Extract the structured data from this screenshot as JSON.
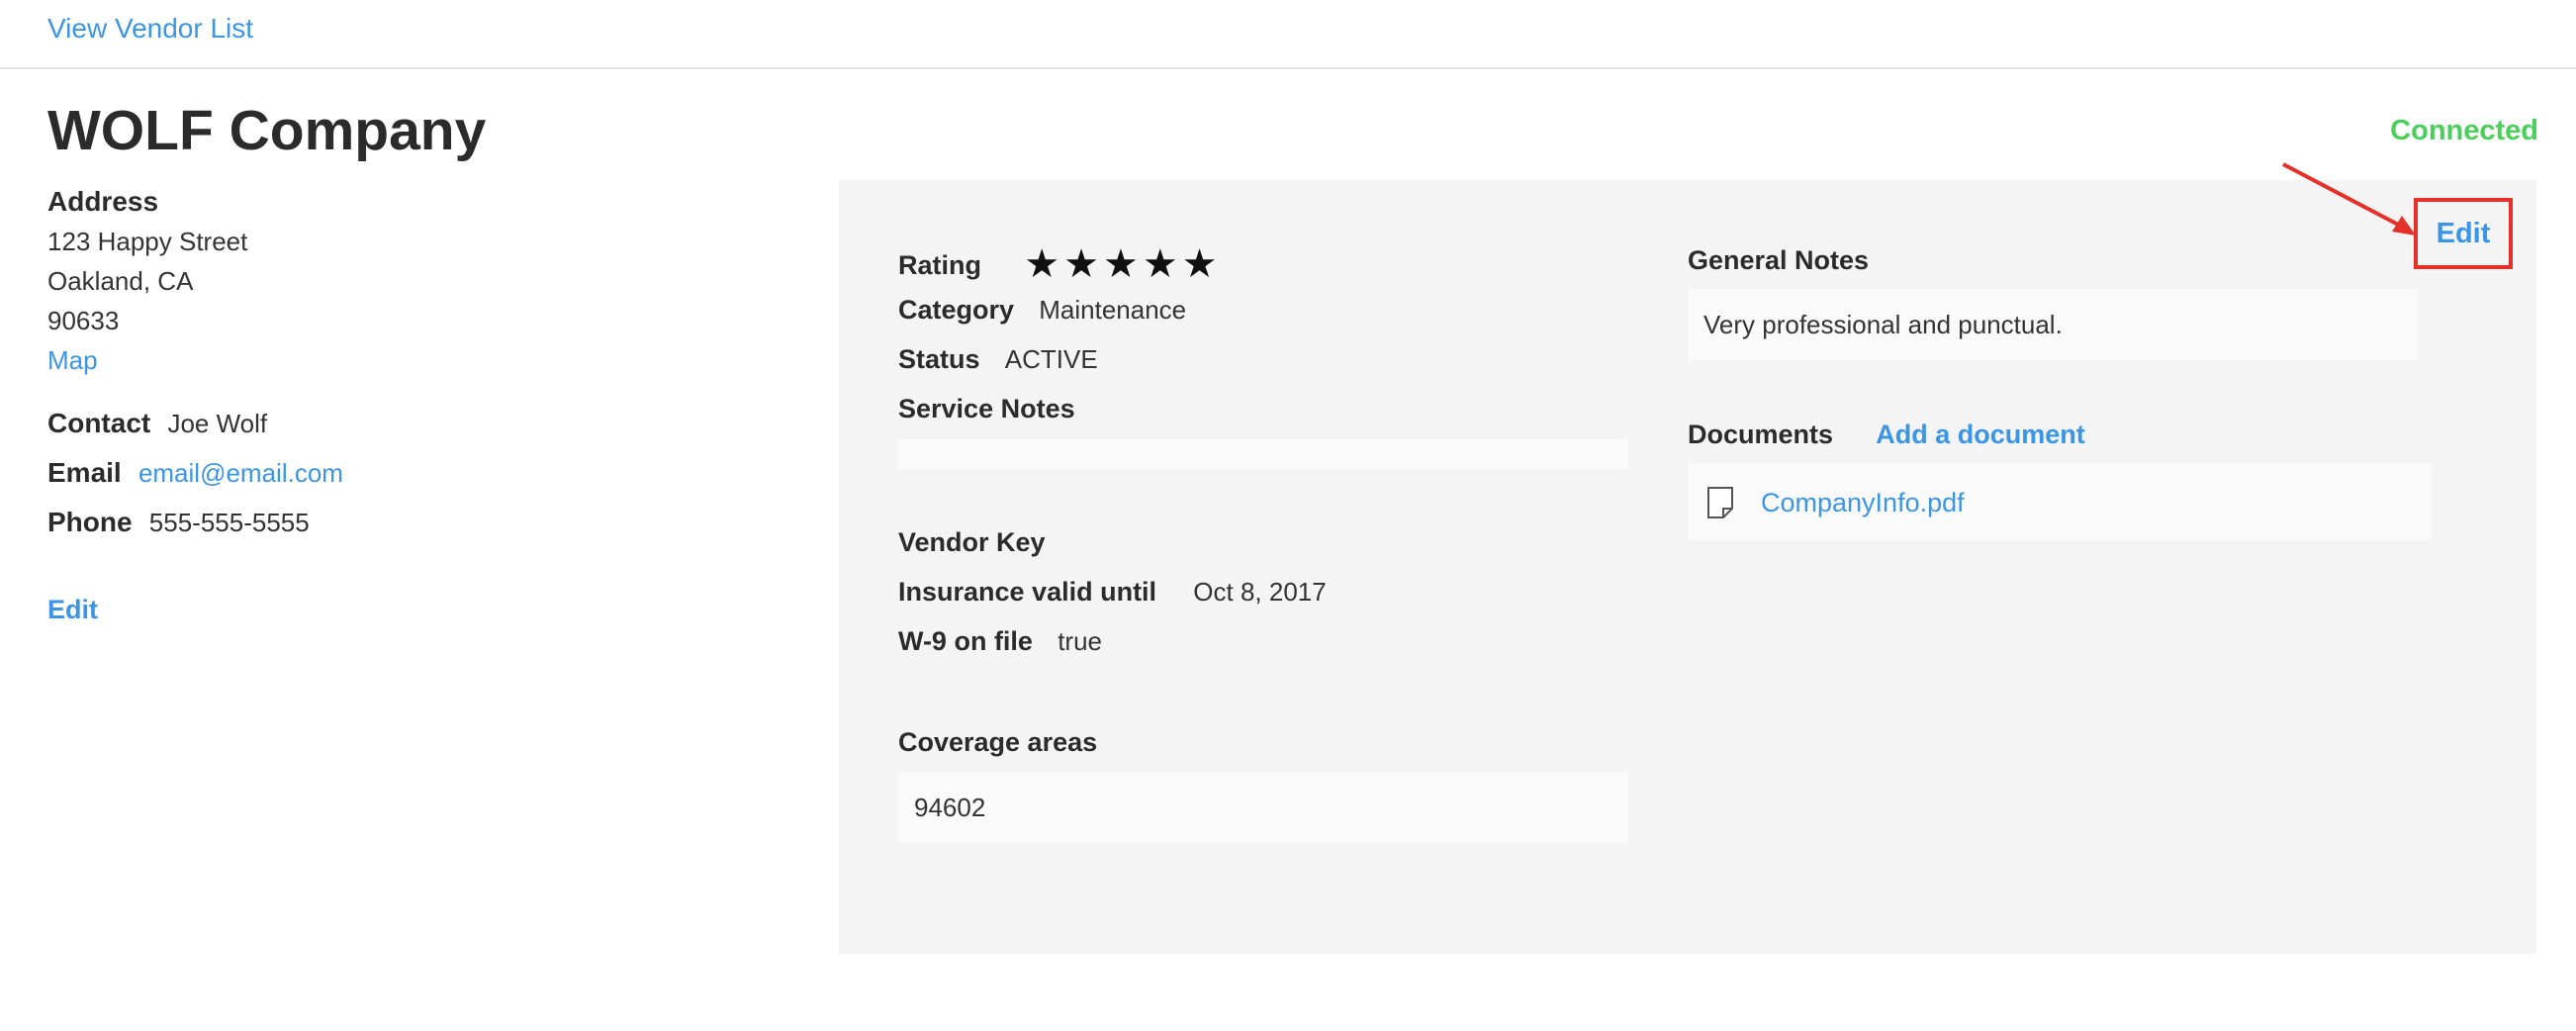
{
  "nav": {
    "view_vendor_list": "View Vendor List"
  },
  "vendor": {
    "name": "WOLF Company",
    "connection_status": "Connected"
  },
  "address": {
    "heading": "Address",
    "street": "123 Happy Street",
    "city_state": "Oakland, CA",
    "zip": "90633",
    "map_link": "Map"
  },
  "contact": {
    "contact_label": "Contact",
    "contact_value": "Joe Wolf",
    "email_label": "Email",
    "email_value": "email@email.com",
    "phone_label": "Phone",
    "phone_value": "555-555-5555",
    "edit_label": "Edit"
  },
  "details": {
    "rating_label": "Rating",
    "rating_stars": "★★★★★",
    "rating_value": 5,
    "rating_max": 5,
    "category_label": "Category",
    "category_value": "Maintenance",
    "status_label": "Status",
    "status_value": "ACTIVE",
    "service_notes_label": "Service Notes",
    "service_notes_value": "",
    "vendor_key_label": "Vendor Key",
    "insurance_label": "Insurance valid until",
    "insurance_value": "Oct 8, 2017",
    "w9_label": "W-9 on file",
    "w9_value": "true",
    "coverage_label": "Coverage areas",
    "coverage_value": "94602"
  },
  "notes": {
    "general_notes_label": "General Notes",
    "general_notes_value": "Very professional and punctual.",
    "documents_label": "Documents",
    "add_document_label": "Add a document",
    "documents": [
      {
        "name": "CompanyInfo.pdf",
        "icon": "document-icon"
      }
    ],
    "edit_label": "Edit"
  },
  "colors": {
    "link": "#3b95e6",
    "connected": "#4ad05a",
    "annotation": "#e53027",
    "panel_bg": "#f4f4f4"
  }
}
